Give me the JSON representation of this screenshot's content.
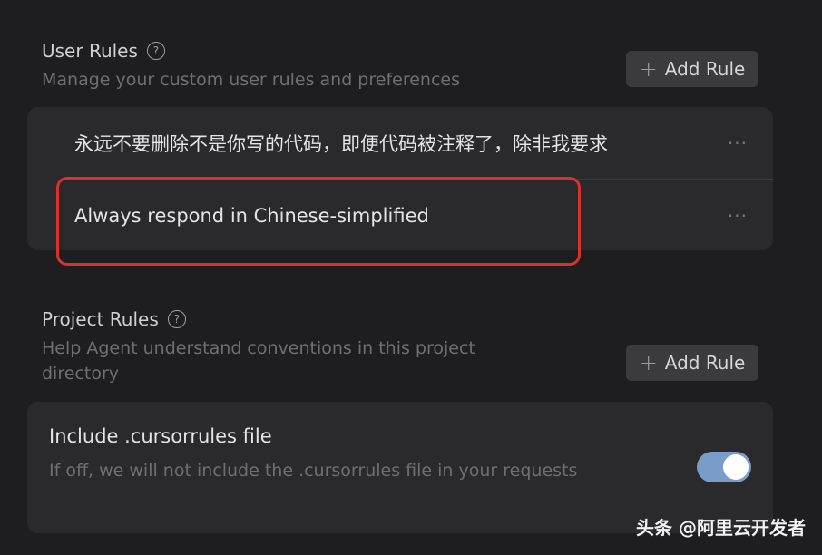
{
  "user_rules": {
    "title": "User Rules",
    "help_icon": "?",
    "description": "Manage your custom user rules and preferences",
    "add_button": {
      "icon": "+",
      "label": "Add Rule"
    },
    "rules": [
      {
        "text": "永远不要删除不是你写的代码，即便代码被注释了，除非我要求",
        "more_icon": "···"
      },
      {
        "text": "Always respond in Chinese-simplified",
        "more_icon": "···"
      }
    ]
  },
  "project_rules": {
    "title": "Project Rules",
    "help_icon": "?",
    "description_line1": "Help Agent understand conventions in this project",
    "description_line2": "directory",
    "add_button": {
      "icon": "+",
      "label": "Add Rule"
    }
  },
  "cursorrules": {
    "title": "Include .cursorrules file",
    "description": "If off, we will not include the .cursorrules file in your requests",
    "toggle_on": true,
    "toggle_color": "#7a9cc8"
  },
  "highlight_color": "#d7322d",
  "watermark": "头条 @阿里云开发者"
}
